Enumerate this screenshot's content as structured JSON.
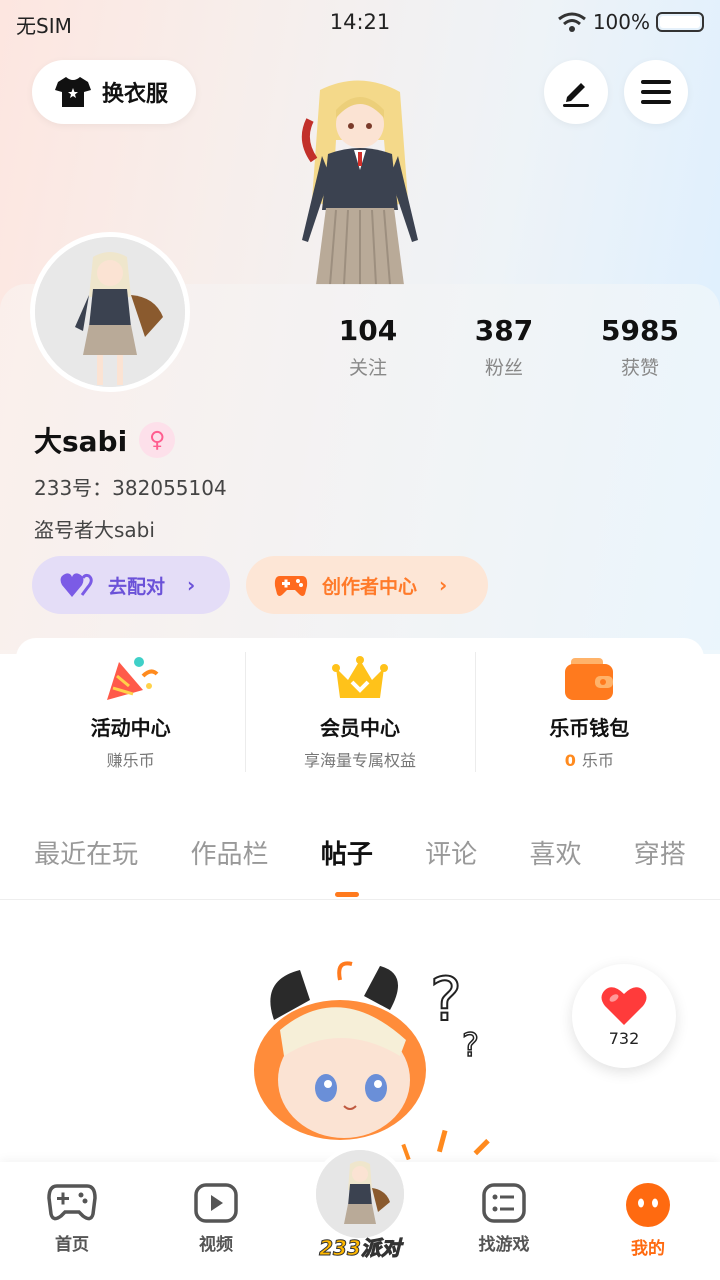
{
  "status_bar": {
    "carrier": "无SIM",
    "time": "14:21",
    "battery": "100%"
  },
  "header": {
    "outfit_label": "换衣服"
  },
  "stats": [
    {
      "value": "104",
      "label": "关注"
    },
    {
      "value": "387",
      "label": "粉丝"
    },
    {
      "value": "5985",
      "label": "获赞"
    }
  ],
  "profile": {
    "name": "大sabi",
    "uid": "233号：382055104",
    "signature": "盗号者大sabi"
  },
  "actions": {
    "match": "去配对",
    "creator": "创作者中心"
  },
  "features": [
    {
      "title": "活动中心",
      "sub": "赚乐币"
    },
    {
      "title": "会员中心",
      "sub": "享海量专属权益"
    },
    {
      "title": "乐币钱包",
      "sub_value": "0",
      "sub": "乐币"
    }
  ],
  "tabs": [
    "最近在玩",
    "作品栏",
    "帖子",
    "评论",
    "喜欢",
    "穿搭"
  ],
  "like_float": {
    "count": "732"
  },
  "bottom_nav": {
    "home": "首页",
    "video": "视频",
    "center": "233派对",
    "games": "找游戏",
    "me": "我的"
  },
  "colors": {
    "accent": "#ff7a1e",
    "match": "#6b52d8",
    "creator": "#ff7a2a",
    "heart": "#ff3b3b"
  }
}
